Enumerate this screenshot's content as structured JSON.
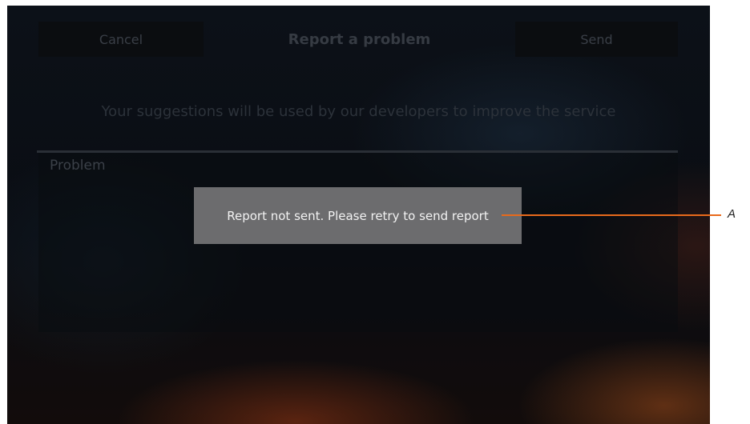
{
  "header": {
    "cancel_label": "Cancel",
    "title": "Report a problem",
    "send_label": "Send"
  },
  "subtitle": "Your suggestions will be used by our developers to improve the service",
  "form": {
    "problem_placeholder": "Problem"
  },
  "toast": {
    "message": "Report not sent. Please retry to send report"
  },
  "callout": {
    "label": "A",
    "color": "#e86a1c"
  }
}
